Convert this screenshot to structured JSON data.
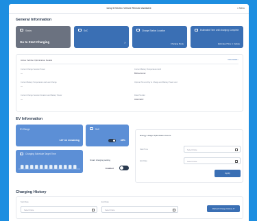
{
  "app_title": "Ioniq 5 Electric Vehicle Remote Assistant",
  "menu_label": "≡ Menu",
  "general": {
    "title": "General Information",
    "cards": [
      {
        "label": "Status",
        "value": "Go to Start Charging"
      },
      {
        "label": "SoC",
        "value": "",
        "chevron": "›"
      },
      {
        "label": "Charge Station Location",
        "value": "Charging Mode"
      },
      {
        "label": "Estimated Time until charging Complete",
        "value": "Estimated Time    ⏲ Update"
      }
    ],
    "details": {
      "title": "Active Vehicle Optimization Details",
      "link": "View Details ›",
      "left": [
        {
          "label": "Current Charge Session Power",
          "value": "—"
        },
        {
          "label": "Current Battery Temperature and Last Charge",
          "value": "—"
        },
        {
          "label": "Current Charge Session Duration and Battery Power",
          "value": "—"
        }
      ],
      "right": [
        {
          "label": "Current Battery Temperature Hold",
          "value": "Bidirectional"
        },
        {
          "label": "Optimal Time to Pay to Charge and Battery Power and",
          "value": ""
        },
        {
          "label": "Data Provider",
          "value": "Automatic"
        }
      ]
    }
  },
  "ev": {
    "title": "EV Information",
    "range_card": {
      "label": "EV Range",
      "value": "127 mi remaining"
    },
    "battery_card": {
      "label": "SoC",
      "value": "48%"
    },
    "schedule_card": {
      "label": "Charging Schedule Target Time"
    },
    "smart_charging": {
      "label": "Smart charging setting",
      "state": "Enabled"
    },
    "optimization": {
      "title": "Energy Usage Optimization Hours",
      "start_label": "Start Time",
      "start_placeholder": "Select Date",
      "end_label": "End Date",
      "end_placeholder": "Select Date",
      "apply_label": "Apply"
    }
  },
  "history": {
    "title": "Charging History",
    "start_label": "Start Date",
    "start_placeholder": "Select Date",
    "end_label": "End Date",
    "end_placeholder": "Select Date",
    "submit_label": "Refresh Charge History ⟳"
  },
  "colors": {
    "card_gray": "#6b7280",
    "card_blue": "#3a6fb4",
    "card_light": "#5c8fd6",
    "accent": "#1d8ee0"
  }
}
